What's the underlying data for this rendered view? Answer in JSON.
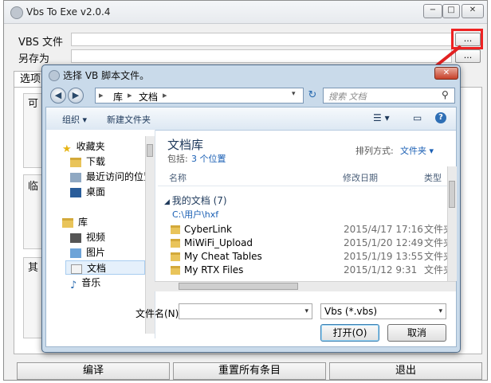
{
  "main_window": {
    "title": "Vbs To Exe v2.0.4",
    "controls": {
      "minimize": "−",
      "maximize": "□",
      "close": "✕"
    },
    "vbs_file_label": "VBS 文件",
    "save_as_label": "另存为",
    "browse_label": "...",
    "options_tab": "选项",
    "group1_label": "可",
    "group2_label": "临",
    "group3_label": "其",
    "buttons": {
      "compile": "编译",
      "reset": "重置所有条目",
      "exit": "退出"
    }
  },
  "dialog": {
    "title": "选择 VB 脚本文件。",
    "close": "✕",
    "breadcrumb": [
      "库",
      "文档"
    ],
    "search_placeholder": "搜索 文档",
    "toolbar": {
      "organize": "组织 ▾",
      "new_folder": "新建文件夹"
    },
    "sidebar": {
      "favorites": "收藏夹",
      "items": [
        "下载",
        "最近访问的位置",
        "桌面"
      ],
      "libraries": "库",
      "lib_items": [
        "视频",
        "图片",
        "文档",
        "音乐"
      ]
    },
    "library_title": "文档库",
    "library_includes": "包括: ",
    "library_locations": "3 个位置",
    "arrange_label": "排列方式:",
    "arrange_value": "文件夹 ▾",
    "columns": {
      "name": "名称",
      "date": "修改日期",
      "type": "类型"
    },
    "group_header": "我的文档 (7)",
    "group_path": "C:\\用户\\hxf",
    "files": [
      {
        "name": "CyberLink",
        "date": "2015/4/17 17:16",
        "type": "文件夹"
      },
      {
        "name": "MiWiFi_Upload",
        "date": "2015/1/20 12:49",
        "type": "文件夹"
      },
      {
        "name": "My Cheat Tables",
        "date": "2015/1/19 13:55",
        "type": "文件夹"
      },
      {
        "name": "My RTX Files",
        "date": "2015/1/12 9:31",
        "type": "文件夹"
      }
    ],
    "filename_label": "文件名(N):",
    "filename_value": "",
    "filter_value": "Vbs (*.vbs)",
    "open_button": "打开(O)",
    "cancel_button": "取消"
  },
  "colors": {
    "annotation": "#e22222",
    "link_blue": "#1a5fb4"
  }
}
